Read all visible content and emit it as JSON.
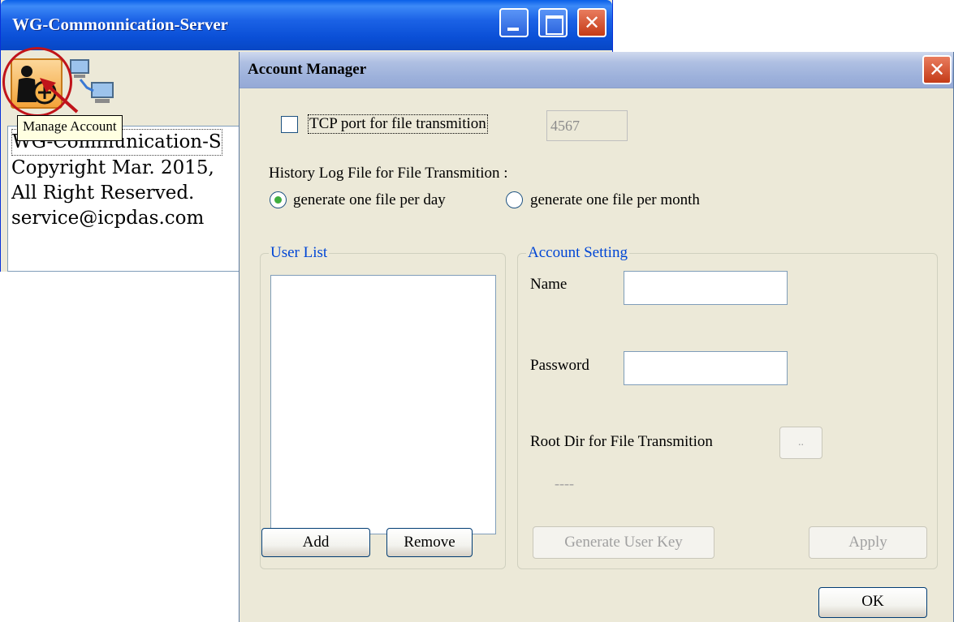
{
  "main_window": {
    "title": "WG-Commonnication-Server",
    "tooltip": "Manage Account",
    "about_lines": [
      "WG-Communication-S",
      "Copyright Mar. 2015,",
      "All Right Reserved.",
      "service@icpdas.com"
    ]
  },
  "dialog": {
    "title": "Account Manager",
    "tcp_port_label": "TCP port for file transmition",
    "tcp_port_value": "4567",
    "history_label": "History Log File for File Transmition :",
    "radio_per_day": "generate one file per day",
    "radio_per_month": "generate one file per month",
    "user_list_title": "User List",
    "add_button": "Add",
    "remove_button": "Remove",
    "account_setting_title": "Account Setting",
    "name_label": "Name",
    "password_label": "Password",
    "root_dir_label": "Root Dir for File Transmition",
    "browse_button": "..",
    "root_dir_value": "----",
    "generate_key_button": "Generate User Key",
    "apply_button": "Apply",
    "ok_button": "OK"
  },
  "icons": [
    "manage-account-icon",
    "network-icon",
    "minimize-icon",
    "maximize-icon",
    "close-icon"
  ],
  "colors": {
    "titlebar_blue": "#0a4fd6",
    "dialog_titlebar": "#aebfe2",
    "group_title_blue": "#0046d5",
    "highlight_red": "#c0141a",
    "window_bg": "#ece9d8"
  }
}
